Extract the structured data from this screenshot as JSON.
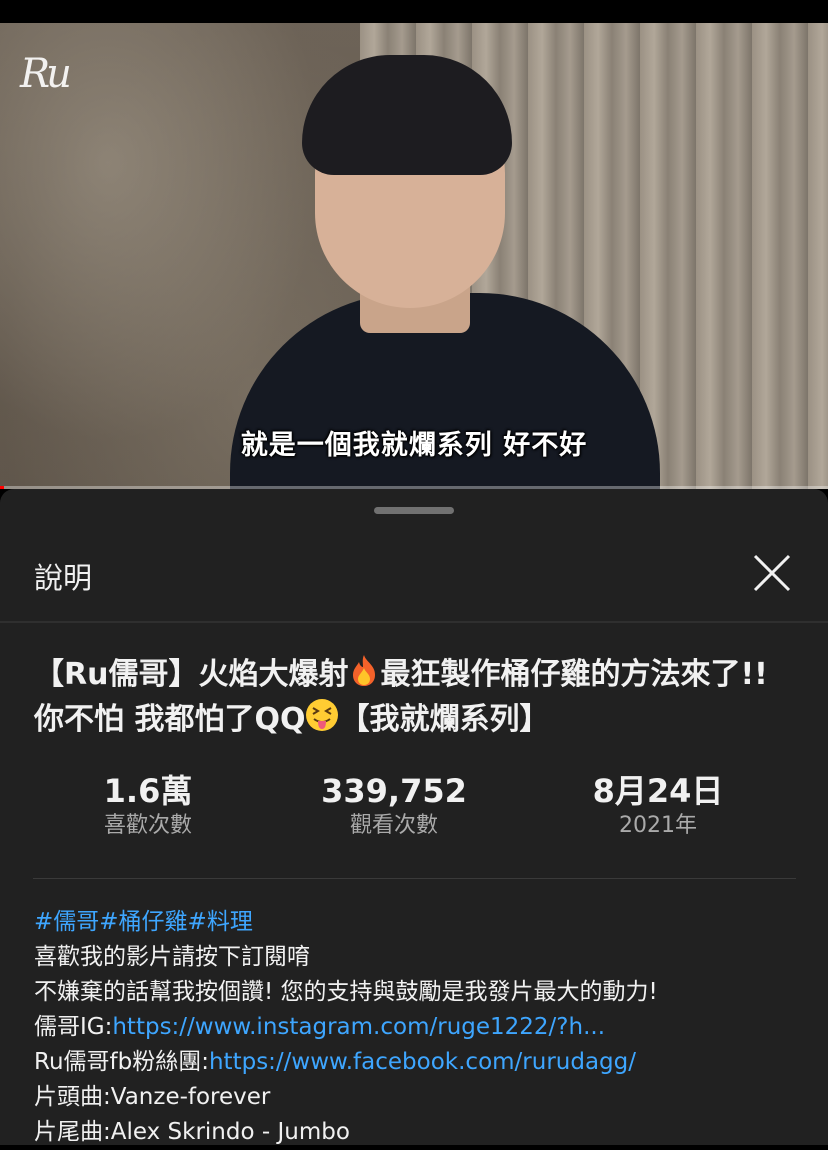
{
  "video": {
    "subtitle": "就是一個我就爛系列 好不好",
    "watermark": "Ru",
    "progress_fraction": 0.005
  },
  "sheet": {
    "title": "說明",
    "close_icon": "close-icon"
  },
  "video_title": {
    "part1": "【Ru儒哥】火焰大爆射",
    "emoji1": "fire-emoji",
    "part2": "最狂製作桶仔雞的方法來了!!你不怕 我都怕了QQ",
    "emoji2": "squinting-tongue-emoji",
    "part3": "【我就爛系列】"
  },
  "stats": [
    {
      "value": "1.6萬",
      "label": "喜歡次數"
    },
    {
      "value": "339,752",
      "label": "觀看次數"
    },
    {
      "value": "8月24日",
      "label": "2021年"
    }
  ],
  "description": {
    "hashtags": "#儒哥#桶仔雞#料理",
    "line1": "喜歡我的影片請按下訂閱唷",
    "line2": "不嫌棄的話幫我按個讚! 您的支持與鼓勵是我發片最大的動力!",
    "ig_label": "儒哥IG:",
    "ig_link": "https://www.instagram.com/ruge1222/?h...",
    "fb_label": "Ru儒哥fb粉絲團:",
    "fb_link": "https://www.facebook.com/rurudagg/",
    "intro_music": "片頭曲:Vanze-forever",
    "outro_music": "片尾曲:Alex Skrindo - Jumbo"
  }
}
